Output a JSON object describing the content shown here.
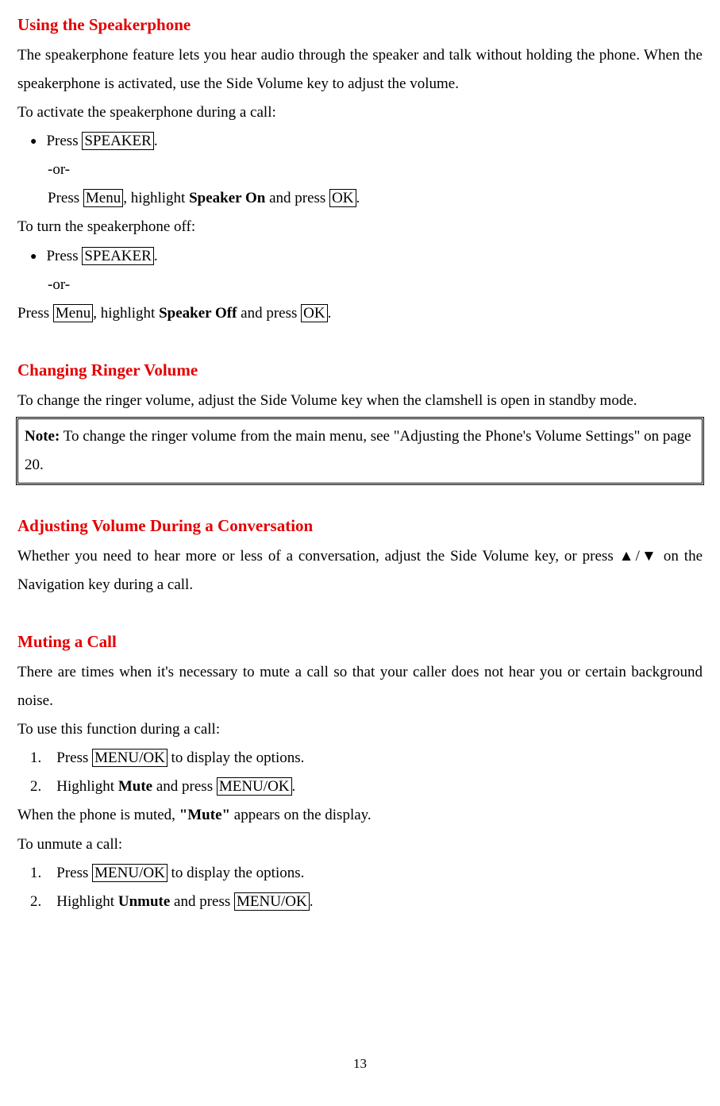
{
  "s1": {
    "heading": "Using the Speakerphone",
    "p1": "The speakerphone feature lets you hear audio through the speaker and talk without holding the phone. When the speakerphone is activated, use the Side Volume key to adjust the volume.",
    "p2": "To activate the speakerphone during a call:",
    "b1a": "Press ",
    "b1key": "SPEAKER",
    "b1c": ".",
    "or": "-or-",
    "b2a": "Press ",
    "b2key1": "Menu",
    "b2b": ", highlight ",
    "b2bold": "Speaker On",
    "b2c": " and press ",
    "b2key2": "OK",
    "b2d": ".",
    "p3": "To turn the speakerphone off:",
    "b3a": "Press ",
    "b3key": "SPEAKER",
    "b3c": ".",
    "p4a": "Press ",
    "p4key1": "Menu",
    "p4b": ", highlight ",
    "p4bold": "Speaker Off",
    "p4c": " and press ",
    "p4key2": "OK",
    "p4d": "."
  },
  "s2": {
    "heading": "Changing Ringer Volume",
    "p1": "To change the ringer volume, adjust the Side Volume key when the clamshell is open in standby mode.",
    "noteLabel": "Note:",
    "noteText": " To change the ringer volume from the main menu, see \"Adjusting the Phone's Volume Settings\" on page 20."
  },
  "s3": {
    "heading": "Adjusting Volume During a Conversation",
    "p1": "Whether you need to hear more or less of a conversation, adjust the Side Volume key, or press ▲/▼  on the Navigation key during a call."
  },
  "s4": {
    "heading": "Muting a Call",
    "p1": "There are times when it's necessary to mute a call so that your caller does not hear you or certain background noise.",
    "p2": "To use this function during a call:",
    "n1a": "1.",
    "n1b": "Press ",
    "n1key": "MENU/OK",
    "n1c": " to display the options.",
    "n2a": "2.",
    "n2b": "Highlight ",
    "n2bold": "Mute",
    "n2c": " and press ",
    "n2key": "MENU/OK",
    "n2d": ".",
    "p3a": "When the phone is muted, ",
    "p3bold": "\"Mute\"",
    "p3b": " appears on the display.",
    "p4": "To unmute a call:",
    "n3a": "1.",
    "n3b": "Press ",
    "n3key": "MENU/OK",
    "n3c": " to display the options.",
    "n4a": "2.",
    "n4b": "Highlight ",
    "n4bold": "Unmute",
    "n4c": " and press ",
    "n4key": "MENU/OK",
    "n4d": "."
  },
  "pageNumber": "13"
}
